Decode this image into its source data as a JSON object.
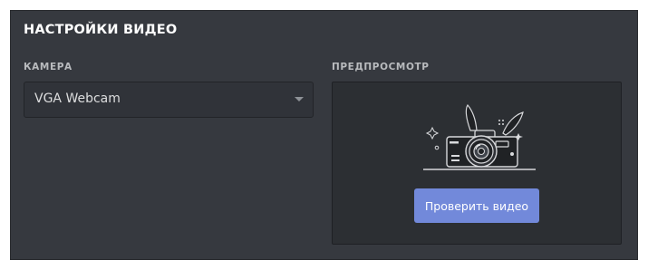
{
  "section": {
    "title": "НАСТРОЙКИ ВИДЕО"
  },
  "camera": {
    "label": "КАМЕРА",
    "selected": "VGA Webcam"
  },
  "preview": {
    "label": "ПРЕДПРОСМОТР",
    "button_label": "Проверить видео"
  },
  "colors": {
    "panel_background": "#36393f",
    "preview_background": "#2c2f33",
    "button_accent": "#7289da"
  },
  "icons": {
    "dropdown": "chevron-down-icon",
    "illustration": "camera-illustration"
  }
}
